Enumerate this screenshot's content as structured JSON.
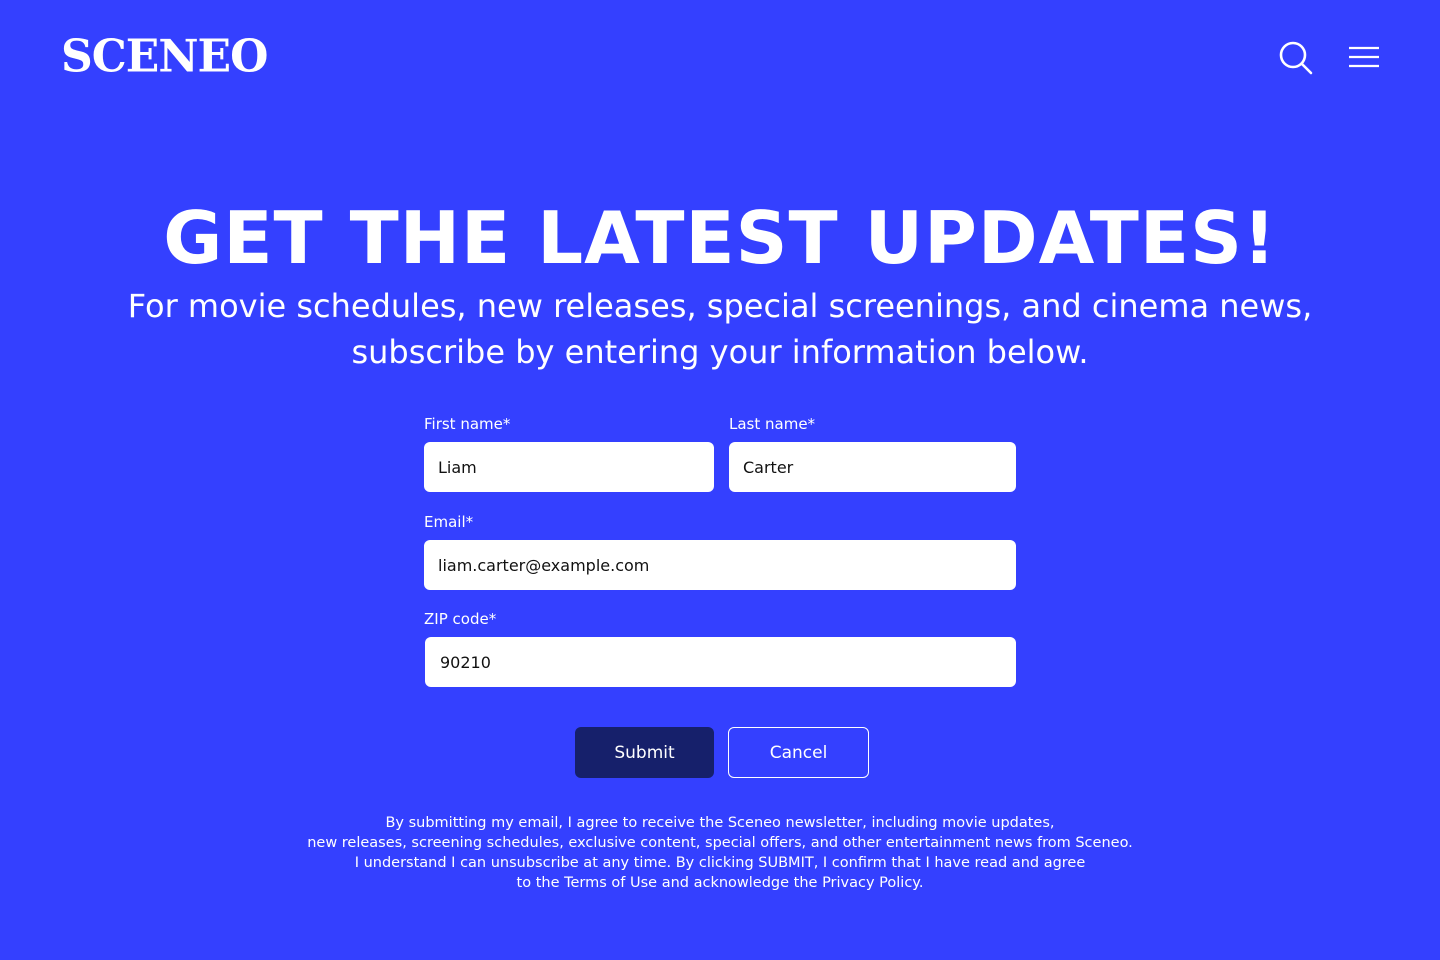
{
  "brand": {
    "logo_text": "SCENEO",
    "background_color": "#3440FF",
    "submit_color": "#16206B"
  },
  "header": {
    "search_icon": "search-icon",
    "menu_icon": "hamburger-menu-icon"
  },
  "hero": {
    "headline": "GET THE LATEST UPDATES!",
    "subheadline_line1": "For movie schedules, new releases, special screenings, and cinema news,",
    "subheadline_line2": "subscribe by entering your information below."
  },
  "form": {
    "first_name": {
      "label": "First name*",
      "value": "Liam"
    },
    "last_name": {
      "label": "Last name*",
      "value": "Carter"
    },
    "email": {
      "label": "Email*",
      "value": "liam.carter@example.com"
    },
    "zip": {
      "label": "ZIP code*",
      "value": "90210"
    },
    "submit_label": "Submit",
    "cancel_label": "Cancel"
  },
  "disclaimer": {
    "line1": "By submitting my email, I agree to receive the Sceneo newsletter, including movie updates,",
    "line2": "new releases, screening schedules, exclusive content, special offers, and other entertainment news from Sceneo.",
    "line3": "I understand I can unsubscribe at any time. By clicking SUBMIT, I confirm that I have read and agree",
    "line4": "to the Terms of Use and acknowledge the Privacy Policy."
  }
}
